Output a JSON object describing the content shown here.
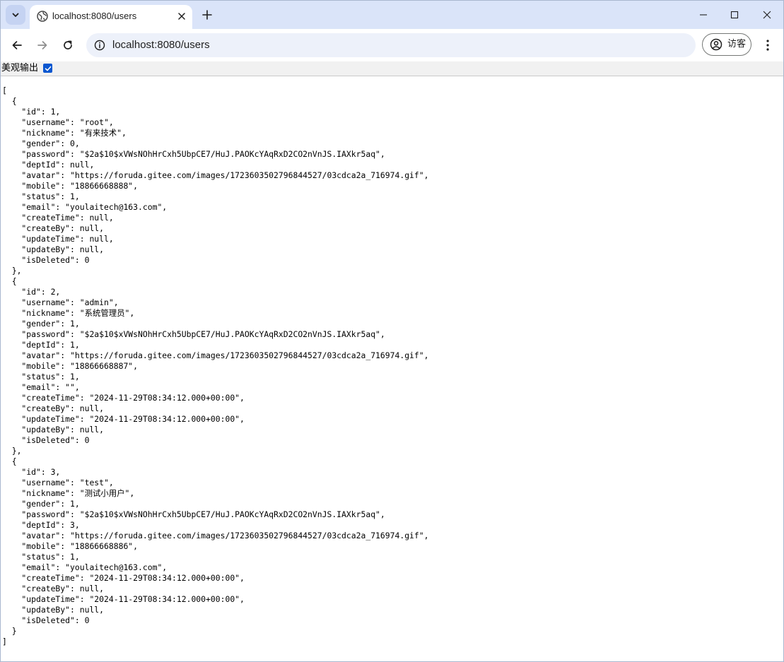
{
  "tab": {
    "title": "localhost:8080/users"
  },
  "address_bar": {
    "url": "localhost:8080/users"
  },
  "profile": {
    "label": "访客"
  },
  "json_viewer": {
    "pretty_print_label": "美观输出",
    "pretty_print_checked": true,
    "content": "[\n  {\n    \"id\": 1,\n    \"username\": \"root\",\n    \"nickname\": \"有来技术\",\n    \"gender\": 0,\n    \"password\": \"$2a$10$xVWsNOhHrCxh5UbpCE7/HuJ.PAOKcYAqRxD2CO2nVnJS.IAXkr5aq\",\n    \"deptId\": null,\n    \"avatar\": \"https://foruda.gitee.com/images/1723603502796844527/03cdca2a_716974.gif\",\n    \"mobile\": \"18866668888\",\n    \"status\": 1,\n    \"email\": \"youlaitech@163.com\",\n    \"createTime\": null,\n    \"createBy\": null,\n    \"updateTime\": null,\n    \"updateBy\": null,\n    \"isDeleted\": 0\n  },\n  {\n    \"id\": 2,\n    \"username\": \"admin\",\n    \"nickname\": \"系统管理员\",\n    \"gender\": 1,\n    \"password\": \"$2a$10$xVWsNOhHrCxh5UbpCE7/HuJ.PAOKcYAqRxD2CO2nVnJS.IAXkr5aq\",\n    \"deptId\": 1,\n    \"avatar\": \"https://foruda.gitee.com/images/1723603502796844527/03cdca2a_716974.gif\",\n    \"mobile\": \"18866668887\",\n    \"status\": 1,\n    \"email\": \"\",\n    \"createTime\": \"2024-11-29T08:34:12.000+00:00\",\n    \"createBy\": null,\n    \"updateTime\": \"2024-11-29T08:34:12.000+00:00\",\n    \"updateBy\": null,\n    \"isDeleted\": 0\n  },\n  {\n    \"id\": 3,\n    \"username\": \"test\",\n    \"nickname\": \"测试小用户\",\n    \"gender\": 1,\n    \"password\": \"$2a$10$xVWsNOhHrCxh5UbpCE7/HuJ.PAOKcYAqRxD2CO2nVnJS.IAXkr5aq\",\n    \"deptId\": 3,\n    \"avatar\": \"https://foruda.gitee.com/images/1723603502796844527/03cdca2a_716974.gif\",\n    \"mobile\": \"18866668886\",\n    \"status\": 1,\n    \"email\": \"youlaitech@163.com\",\n    \"createTime\": \"2024-11-29T08:34:12.000+00:00\",\n    \"createBy\": null,\n    \"updateTime\": \"2024-11-29T08:34:12.000+00:00\",\n    \"updateBy\": null,\n    \"isDeleted\": 0\n  }\n]"
  },
  "icons": {
    "tab_search": "chevron-down-icon",
    "favicon": "globe-icon",
    "tab_close": "close-icon",
    "new_tab": "plus-icon",
    "minimize": "minimize-icon",
    "maximize": "maximize-icon",
    "window_close": "close-icon",
    "back": "arrow-left-icon",
    "forward": "arrow-right-icon",
    "reload": "reload-icon",
    "site_info": "info-icon",
    "profile": "person-circle-icon",
    "menu": "more-vertical-icon",
    "checkbox": "checkmark-icon"
  },
  "colors": {
    "tabstrip_bg": "#dae4f9",
    "omnibox_bg": "#edf1fa",
    "checkbox_accent": "#0b57d0",
    "pretty_bar_bg": "#f1f1f1"
  }
}
